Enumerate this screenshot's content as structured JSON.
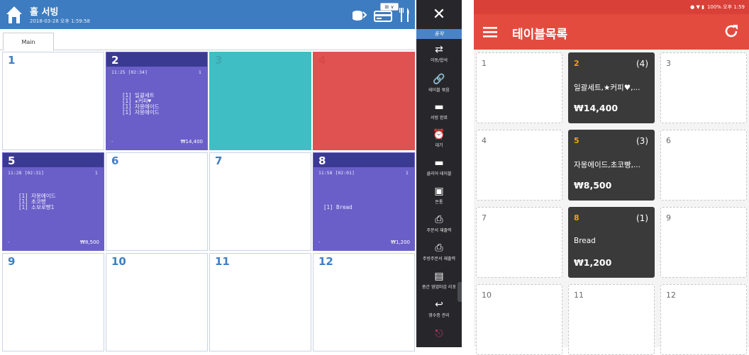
{
  "pos": {
    "title": "홀 서빙",
    "datetime": "2018-03-28 오후 1:59:58",
    "dropdown_label": "⊞ ∨",
    "tabs": [
      "Main"
    ],
    "tables": [
      {
        "num": "1"
      },
      {
        "num": "2",
        "time": "11:25 [02:34]",
        "guests": "1",
        "items": "[1] 일괄세트\n[1] ★커피♥\n[1] 자몽에이드\n[1] 자몽에이드",
        "dash": "-",
        "price": "₩14,400"
      },
      {
        "num": "3"
      },
      {
        "num": "4"
      },
      {
        "num": "5",
        "time": "11:28 [02:31]",
        "guests": "1",
        "items": "[1] 자몽에이드\n[1] 초코빵\n[1] 소보로빵1",
        "dash": "-",
        "price": "₩8,500"
      },
      {
        "num": "6"
      },
      {
        "num": "7"
      },
      {
        "num": "8",
        "time": "11:58 [02:01]",
        "guests": "1",
        "items": "[1] Bread",
        "dash": "-",
        "price": "₩1,200"
      },
      {
        "num": "9"
      },
      {
        "num": "10"
      },
      {
        "num": "11"
      },
      {
        "num": "12"
      }
    ],
    "sidebar": {
      "close": "✕",
      "section": "동작",
      "items": [
        {
          "label": "이동/합석",
          "icon": "⇄"
        },
        {
          "label": "테이블 묶음",
          "icon": "🔗"
        },
        {
          "label": "서빙 완료",
          "icon": "▬"
        },
        {
          "label": "대기",
          "icon": "⏰"
        },
        {
          "label": "클리어 테이블",
          "icon": "▬"
        },
        {
          "label": "돈통",
          "icon": "▣"
        },
        {
          "label": "주문서 재출력",
          "icon": "⎙"
        },
        {
          "label": "주방주문서 재출력",
          "icon": "⎙"
        },
        {
          "label": "중간 영업마감 리포",
          "icon": "▤"
        },
        {
          "label": "영수증 관리",
          "icon": "↩"
        },
        {
          "label": "",
          "icon": "⎋"
        }
      ]
    }
  },
  "mobile": {
    "status": "100% 오후 1:59",
    "title": "테이블목록",
    "tables": [
      {
        "num": "1"
      },
      {
        "num": "2",
        "count": "(4)",
        "items": "일괄세트,★커피♥,...",
        "price": "₩14,400"
      },
      {
        "num": "3"
      },
      {
        "num": "4"
      },
      {
        "num": "5",
        "count": "(3)",
        "items": "자몽에이드,초코빵,...",
        "price": "₩8,500"
      },
      {
        "num": "6"
      },
      {
        "num": "7"
      },
      {
        "num": "8",
        "count": "(1)",
        "items": "Bread",
        "price": "₩1,200"
      },
      {
        "num": "9"
      },
      {
        "num": "10"
      },
      {
        "num": "11"
      },
      {
        "num": "12"
      }
    ]
  },
  "colors": {
    "header_blue": "#3d7cc0",
    "occupied_purple": "#6a5fc8",
    "occupied_header": "#3b3a93",
    "teal": "#3fbfc3",
    "red": "#e05151",
    "mobile_red": "#e44b3f",
    "mobile_occ": "#3a3a3a",
    "mobile_num_orange": "#f0a400"
  }
}
